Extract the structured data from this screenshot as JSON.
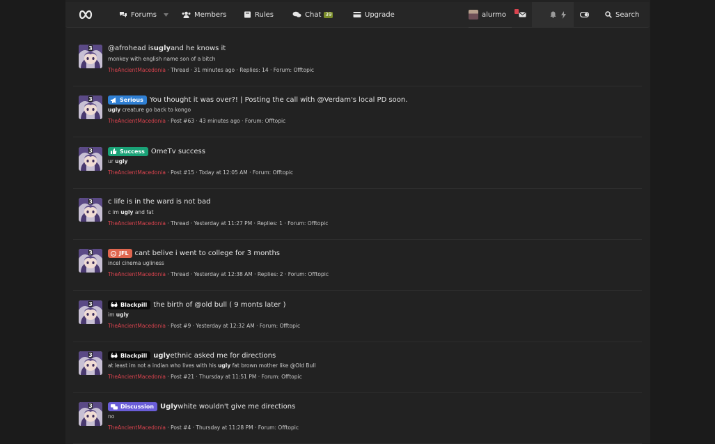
{
  "nav": {
    "forums": "Forums",
    "members": "Members",
    "rules": "Rules",
    "chat": "Chat",
    "chat_badge": "39",
    "upgrade": "Upgrade",
    "username": "alurmo",
    "search": "Search"
  },
  "colors": {
    "accent_red": "#d9434e",
    "tag_serious": "#2f7fd3",
    "tag_success": "#1aa277",
    "tag_jfl": "#e0664f",
    "tag_blackpill": "#0a0a0a",
    "tag_discussion": "#6a5dd8"
  },
  "results": [
    {
      "tag": "",
      "title_pre": "@afrohead is ",
      "title_bold": "ugly",
      "title_post": " and he knows it",
      "snippet_pre": "monkey with english name son of a bitch",
      "snippet_bold": "",
      "snippet_post": "",
      "author": "TheAncientMacedonia",
      "meta": " · Thread · 31 minutes ago · Replies: 14 · Forum: Offtopic"
    },
    {
      "tag": "Serious",
      "title_pre": "You thought it was over?! | Posting the call with @Verdam's local PD soon.",
      "title_bold": "",
      "title_post": "",
      "snippet_pre": "",
      "snippet_bold": "ugly",
      "snippet_post": " creature go back to kongo",
      "author": "TheAncientMacedonia",
      "meta": " · Post #63 · 43 minutes ago · Forum: Offtopic"
    },
    {
      "tag": "Success",
      "title_pre": "OmeTv success",
      "title_bold": "",
      "title_post": "",
      "snippet_pre": "ur ",
      "snippet_bold": "ugly",
      "snippet_post": "",
      "author": "TheAncientMacedonia",
      "meta": " · Post #15 · Today at 12:05 AM · Forum: Offtopic"
    },
    {
      "tag": "",
      "title_pre": "c life is in the ward is not bad",
      "title_bold": "",
      "title_post": "",
      "snippet_pre": "c im ",
      "snippet_bold": "ugly",
      "snippet_post": " and fat",
      "author": "TheAncientMacedonia",
      "meta": " · Thread · Yesterday at 11:27 PM · Replies: 1 · Forum: Offtopic"
    },
    {
      "tag": "JFL",
      "title_pre": "cant belive i went to college for 3 months",
      "title_bold": "",
      "title_post": "",
      "snippet_pre": "incel cinema ugliness",
      "snippet_bold": "",
      "snippet_post": "",
      "author": "TheAncientMacedonia",
      "meta": " · Thread · Yesterday at 12:38 AM · Replies: 2 · Forum: Offtopic"
    },
    {
      "tag": "Blackpill",
      "title_pre": "the birth of @old bull ( 9 monts later )",
      "title_bold": "",
      "title_post": "",
      "snippet_pre": "im ",
      "snippet_bold": "ugly",
      "snippet_post": "",
      "author": "TheAncientMacedonia",
      "meta": " · Post #9 · Yesterday at 12:32 AM · Forum: Offtopic"
    },
    {
      "tag": "Blackpill",
      "title_pre": "",
      "title_bold": "ugly",
      "title_post": " ethnic asked me for directions",
      "snippet_pre": "at least im not a indian who lives with his ",
      "snippet_bold": "ugly",
      "snippet_post": " fat brown mother like @Old Bull",
      "author": "TheAncientMacedonia",
      "meta": " · Post #21 · Thursday at 11:51 PM · Forum: Offtopic"
    },
    {
      "tag": "Discussion",
      "title_pre": "",
      "title_bold": "Ugly",
      "title_post": " white wouldn't give me directions",
      "snippet_pre": "no",
      "snippet_bold": "",
      "snippet_post": "",
      "author": "TheAncientMacedonia",
      "meta": " · Post #4 · Thursday at 11:28 PM · Forum: Offtopic"
    }
  ]
}
